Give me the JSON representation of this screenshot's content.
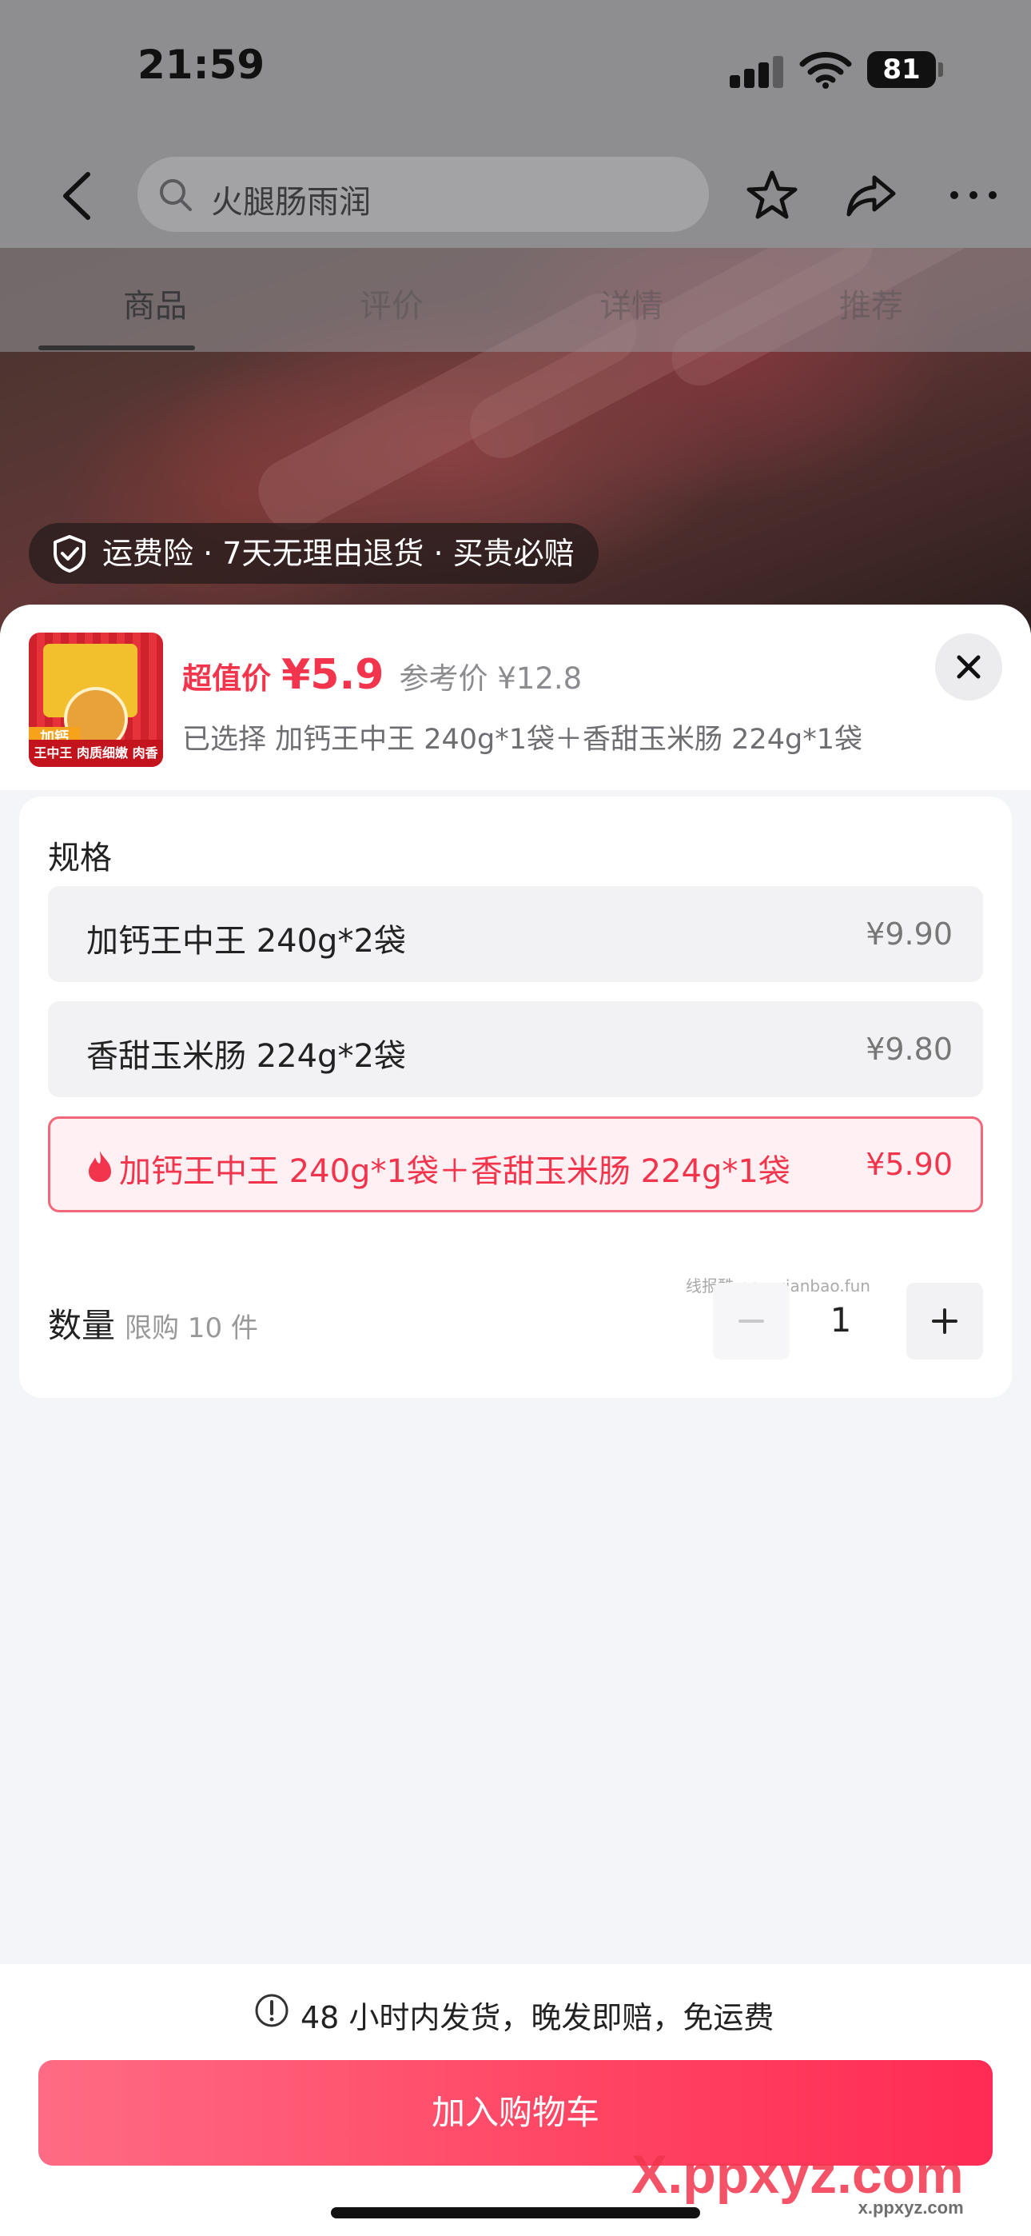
{
  "status_bar": {
    "time": "21:59",
    "battery": "81"
  },
  "nav": {
    "search_text": "火腿肠雨润"
  },
  "tabs": [
    {
      "label": "商品",
      "active": true
    },
    {
      "label": "评价",
      "active": false
    },
    {
      "label": "详情",
      "active": false
    },
    {
      "label": "推荐",
      "active": false
    }
  ],
  "service_pill": "运费险 · 7天无理由退货 · 买贵必赔",
  "sheet": {
    "price_label": "超值价",
    "price_value": "¥5.9",
    "ref_price": "参考价 ¥12.8",
    "selected": "已选择 加钙王中王 240g*1袋＋香甜玉米肠 224g*1袋",
    "thumb_tag": "加钙",
    "thumb_label": "王中王  肉质细嫩  肉香浓郁",
    "spec_title": "规格",
    "options": [
      {
        "label": "加钙王中王 240g*2袋",
        "price": "¥9.90"
      },
      {
        "label": "香甜玉米肠 224g*2袋",
        "price": "¥9.80"
      },
      {
        "label": "加钙王中王 240g*1袋＋香甜玉米肠 224g*1袋",
        "price": "¥5.90"
      }
    ],
    "quantity_label": "数量",
    "quantity_limit": "限购 10 件",
    "quantity_value": "1",
    "watermark": "线报酷-new.xianbao.fun",
    "notice": "48 小时内发货，晚发即赔，免运费",
    "cart_button": "加入购物车"
  },
  "corner_mark": {
    "brand": "X.ppxyz.com",
    "sub": "x.ppxyz.com"
  },
  "colors": {
    "accent": "#f2354d",
    "cart_button": "#ff4362"
  }
}
